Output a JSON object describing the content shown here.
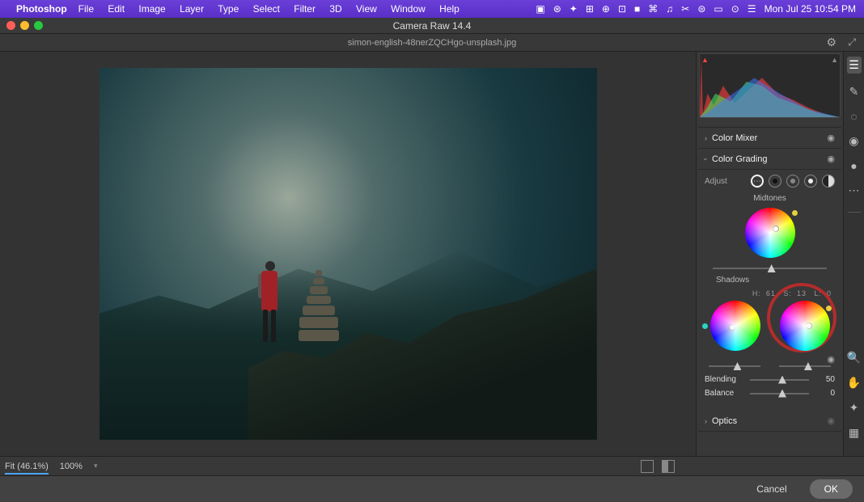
{
  "menubar": {
    "app_name": "Photoshop",
    "menus": [
      "File",
      "Edit",
      "Image",
      "Layer",
      "Type",
      "Select",
      "Filter",
      "3D",
      "View",
      "Window",
      "Help"
    ],
    "clock": "Mon Jul 25  10:54 PM"
  },
  "window": {
    "title": "Camera Raw 14.4",
    "filename": "simon-english-48nerZQCHgo-unsplash.jpg"
  },
  "sidebar": {
    "panels": {
      "color_mixer": {
        "title": "Color Mixer"
      },
      "color_grading": {
        "title": "Color Grading",
        "adjust_label": "Adjust",
        "midtones_label": "Midtones",
        "shadows_label": "Shadows",
        "readout": {
          "h_label": "H:",
          "h": "61",
          "s_label": "S:",
          "s": "13",
          "l_label": "L:",
          "l": "0"
        },
        "blending": {
          "label": "Blending",
          "value": "50"
        },
        "balance": {
          "label": "Balance",
          "value": "0"
        }
      },
      "optics": {
        "title": "Optics"
      }
    }
  },
  "status": {
    "fit_label": "Fit (46.1%)",
    "zoom_label": "100%"
  },
  "actions": {
    "cancel": "Cancel",
    "ok": "OK"
  }
}
